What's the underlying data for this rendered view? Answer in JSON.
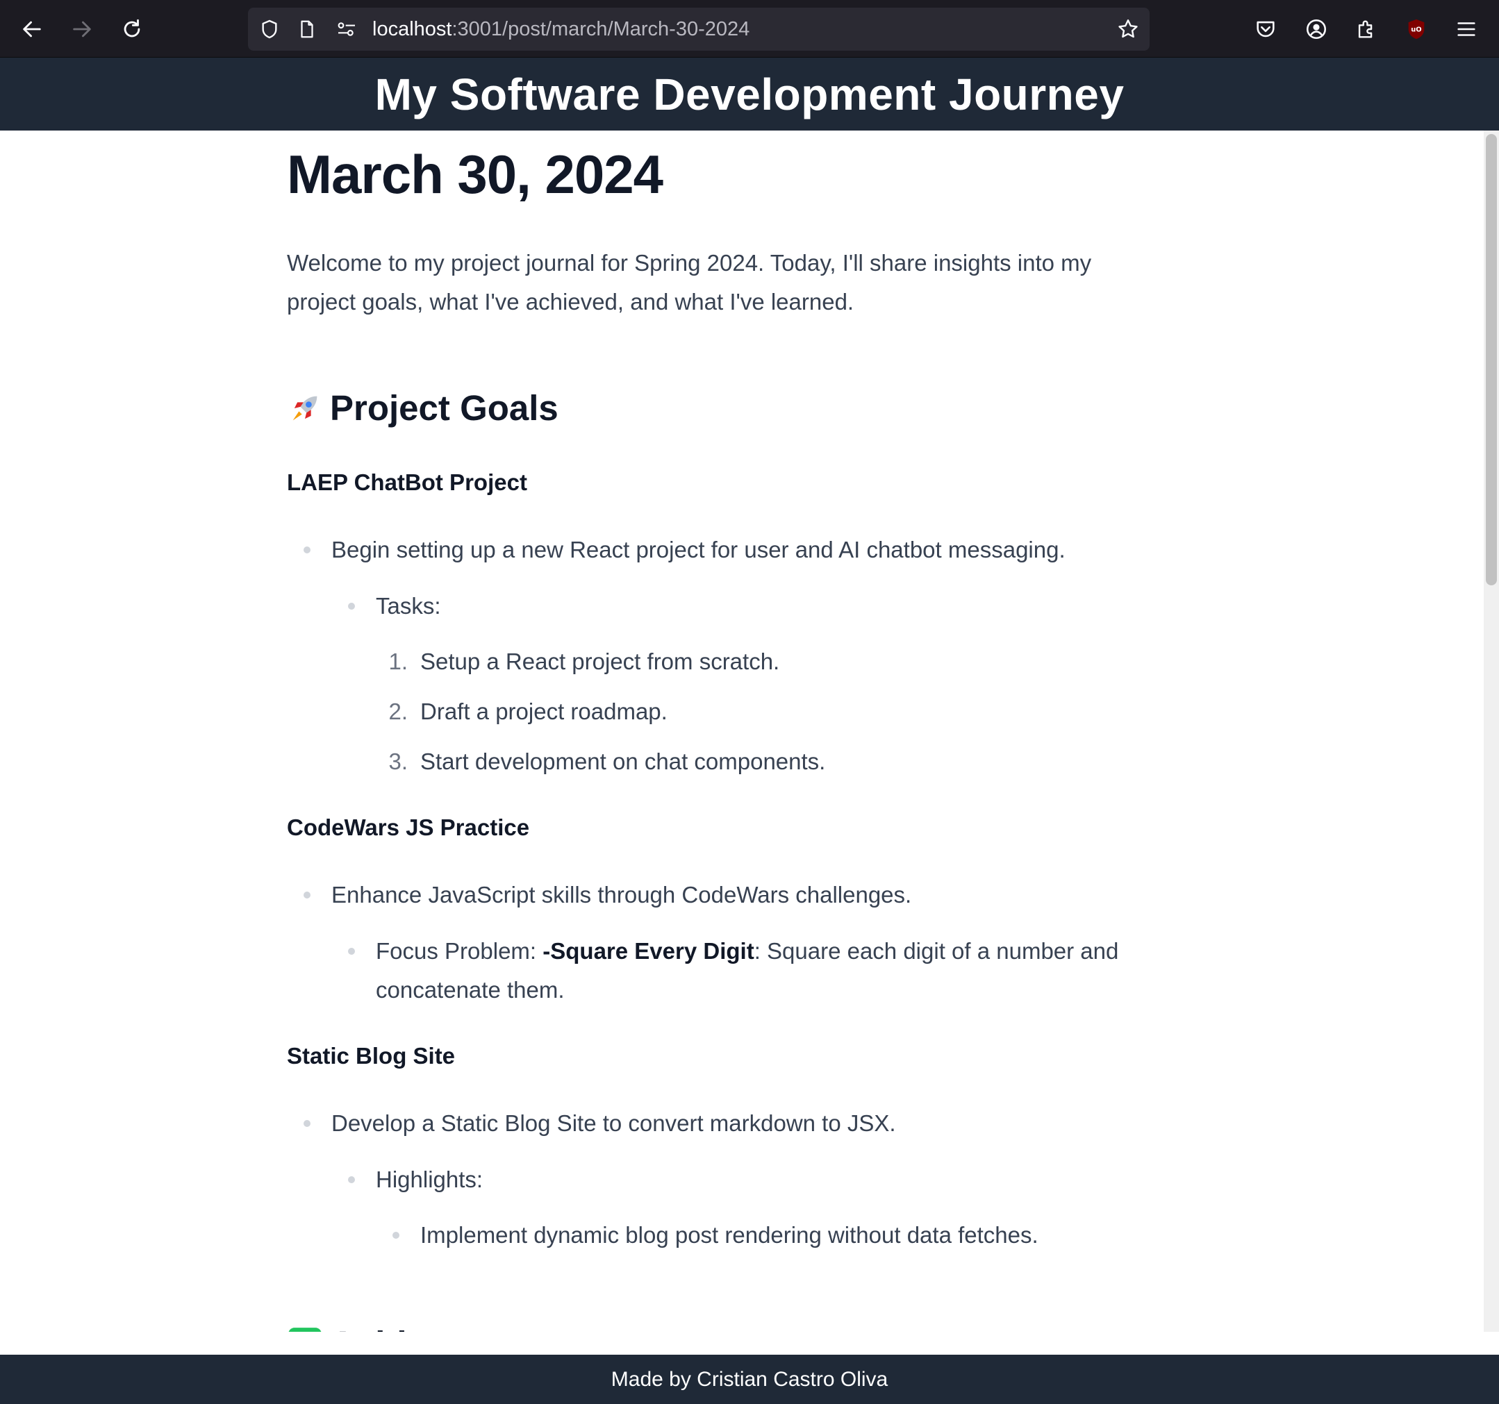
{
  "browser": {
    "url_host": "localhost",
    "url_rest": ":3001/post/march/March-30-2024",
    "icons": [
      "back-icon",
      "forward-icon",
      "reload-icon",
      "shield-icon",
      "page-icon",
      "permissions-icon",
      "bookmark-star-icon",
      "pocket-icon",
      "account-icon",
      "extensions-icon",
      "ublock-icon",
      "menu-icon"
    ]
  },
  "site": {
    "title": "My Software Development Journey",
    "footer": "Made by Cristian Castro Oliva"
  },
  "post": {
    "title": "March 30, 2024",
    "intro": "Welcome to my project journal for Spring 2024. Today, I'll share insights into my project goals, what I've achieved, and what I've learned.",
    "section_goals": "Project Goals",
    "projects": [
      {
        "name": "LAEP ChatBot Project",
        "item": "Begin setting up a new React project for user and AI chatbot messaging.",
        "sub": "Tasks:",
        "tasks": [
          {
            "num": "1.",
            "text": "Setup a React project from scratch."
          },
          {
            "num": "2.",
            "text": "Draft a project roadmap."
          },
          {
            "num": "3.",
            "text": "Start development on chat components."
          }
        ]
      },
      {
        "name": "CodeWars JS Practice",
        "item": "Enhance JavaScript skills through CodeWars challenges.",
        "sub_prefix": "Focus Problem: ",
        "sub_bold": "-Square Every Digit",
        "sub_suffix": ": Square each digit of a number and",
        "sub_line2": "concatenate them."
      },
      {
        "name": "Static Blog Site",
        "item": "Develop a Static Blog Site to convert markdown to JSX.",
        "sub": "Highlights:",
        "highlight": "Implement dynamic blog post rendering without data fetches."
      }
    ],
    "section_next_partial": "Achi"
  }
}
